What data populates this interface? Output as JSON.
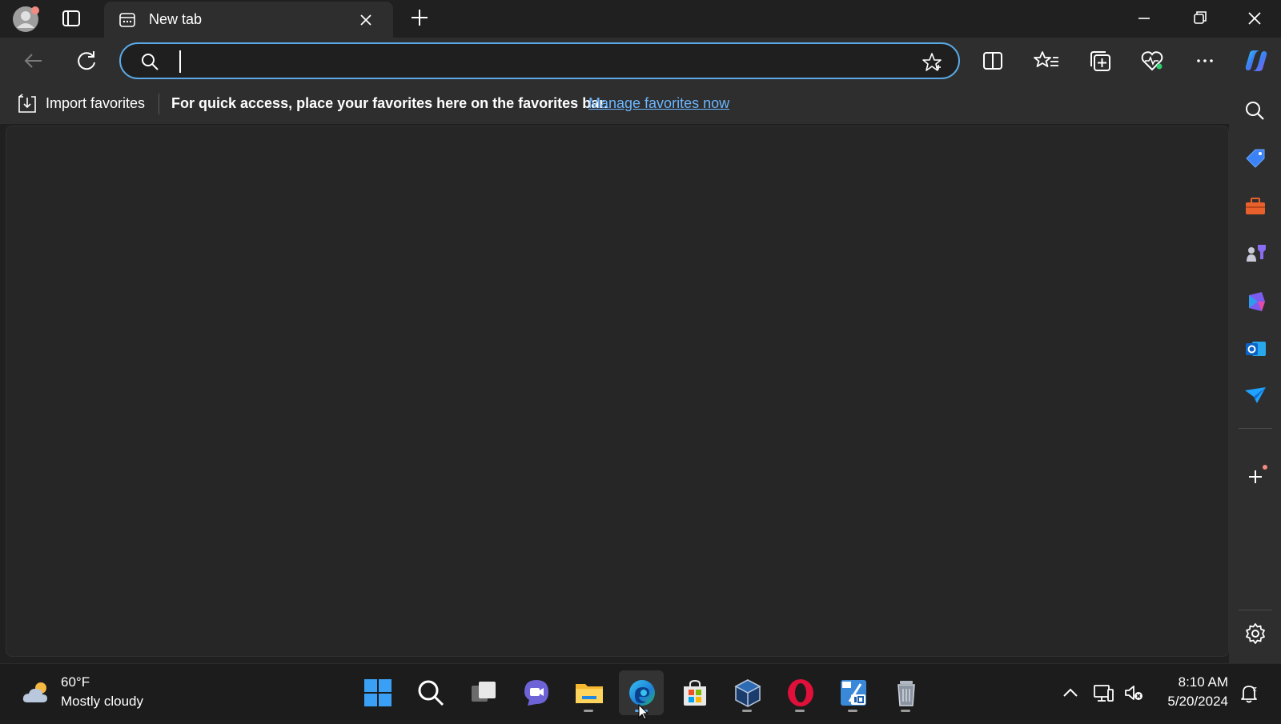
{
  "tab": {
    "title": "New tab"
  },
  "address_bar": {
    "value": "",
    "placeholder": ""
  },
  "favorites_bar": {
    "import_label": "Import favorites",
    "message": "For quick access, place your favorites here on the favorites bar.",
    "manage_link": "Manage favorites now"
  },
  "sidebar": {
    "items": [
      "search-icon",
      "shopping-tag-icon",
      "tools-icon",
      "games-icon",
      "m365-icon",
      "outlook-icon",
      "drop-icon",
      "add-icon",
      "settings-icon"
    ]
  },
  "taskbar": {
    "weather": {
      "temp": "60°F",
      "desc": "Mostly cloudy"
    },
    "apps": [
      "start",
      "search",
      "task-view",
      "teams",
      "file-explorer",
      "edge",
      "store",
      "virtualbox",
      "opera",
      "win10-app",
      "recycle-app"
    ],
    "clock": {
      "time": "8:10 AM",
      "date": "5/20/2024"
    }
  },
  "colors": {
    "accent": "#5aa9e6",
    "link": "#6cb6ff",
    "background": "#202020",
    "toolbar": "#2e2e2e"
  }
}
